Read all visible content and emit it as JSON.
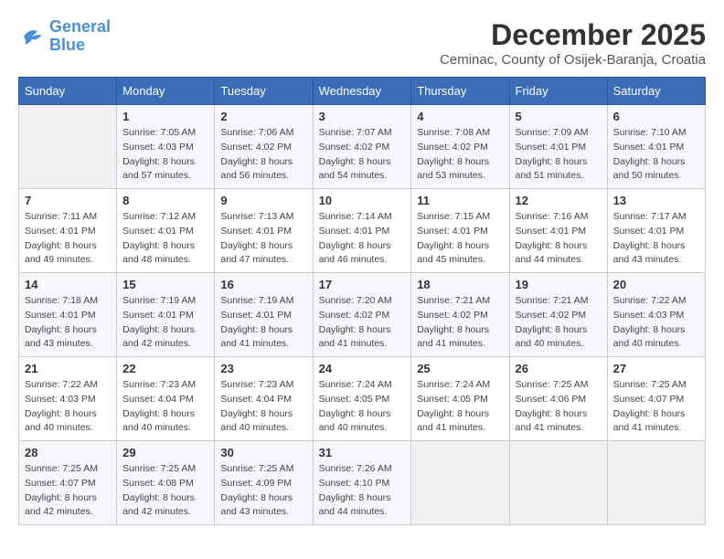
{
  "header": {
    "logo_line1": "General",
    "logo_line2": "Blue",
    "month": "December 2025",
    "location": "Ceminac, County of Osijek-Baranja, Croatia"
  },
  "weekdays": [
    "Sunday",
    "Monday",
    "Tuesday",
    "Wednesday",
    "Thursday",
    "Friday",
    "Saturday"
  ],
  "weeks": [
    [
      {
        "day": "",
        "info": ""
      },
      {
        "day": "1",
        "info": "Sunrise: 7:05 AM\nSunset: 4:03 PM\nDaylight: 8 hours\nand 57 minutes."
      },
      {
        "day": "2",
        "info": "Sunrise: 7:06 AM\nSunset: 4:02 PM\nDaylight: 8 hours\nand 56 minutes."
      },
      {
        "day": "3",
        "info": "Sunrise: 7:07 AM\nSunset: 4:02 PM\nDaylight: 8 hours\nand 54 minutes."
      },
      {
        "day": "4",
        "info": "Sunrise: 7:08 AM\nSunset: 4:02 PM\nDaylight: 8 hours\nand 53 minutes."
      },
      {
        "day": "5",
        "info": "Sunrise: 7:09 AM\nSunset: 4:01 PM\nDaylight: 8 hours\nand 51 minutes."
      },
      {
        "day": "6",
        "info": "Sunrise: 7:10 AM\nSunset: 4:01 PM\nDaylight: 8 hours\nand 50 minutes."
      }
    ],
    [
      {
        "day": "7",
        "info": "Sunrise: 7:11 AM\nSunset: 4:01 PM\nDaylight: 8 hours\nand 49 minutes."
      },
      {
        "day": "8",
        "info": "Sunrise: 7:12 AM\nSunset: 4:01 PM\nDaylight: 8 hours\nand 48 minutes."
      },
      {
        "day": "9",
        "info": "Sunrise: 7:13 AM\nSunset: 4:01 PM\nDaylight: 8 hours\nand 47 minutes."
      },
      {
        "day": "10",
        "info": "Sunrise: 7:14 AM\nSunset: 4:01 PM\nDaylight: 8 hours\nand 46 minutes."
      },
      {
        "day": "11",
        "info": "Sunrise: 7:15 AM\nSunset: 4:01 PM\nDaylight: 8 hours\nand 45 minutes."
      },
      {
        "day": "12",
        "info": "Sunrise: 7:16 AM\nSunset: 4:01 PM\nDaylight: 8 hours\nand 44 minutes."
      },
      {
        "day": "13",
        "info": "Sunrise: 7:17 AM\nSunset: 4:01 PM\nDaylight: 8 hours\nand 43 minutes."
      }
    ],
    [
      {
        "day": "14",
        "info": "Sunrise: 7:18 AM\nSunset: 4:01 PM\nDaylight: 8 hours\nand 43 minutes."
      },
      {
        "day": "15",
        "info": "Sunrise: 7:19 AM\nSunset: 4:01 PM\nDaylight: 8 hours\nand 42 minutes."
      },
      {
        "day": "16",
        "info": "Sunrise: 7:19 AM\nSunset: 4:01 PM\nDaylight: 8 hours\nand 41 minutes."
      },
      {
        "day": "17",
        "info": "Sunrise: 7:20 AM\nSunset: 4:02 PM\nDaylight: 8 hours\nand 41 minutes."
      },
      {
        "day": "18",
        "info": "Sunrise: 7:21 AM\nSunset: 4:02 PM\nDaylight: 8 hours\nand 41 minutes."
      },
      {
        "day": "19",
        "info": "Sunrise: 7:21 AM\nSunset: 4:02 PM\nDaylight: 8 hours\nand 40 minutes."
      },
      {
        "day": "20",
        "info": "Sunrise: 7:22 AM\nSunset: 4:03 PM\nDaylight: 8 hours\nand 40 minutes."
      }
    ],
    [
      {
        "day": "21",
        "info": "Sunrise: 7:22 AM\nSunset: 4:03 PM\nDaylight: 8 hours\nand 40 minutes."
      },
      {
        "day": "22",
        "info": "Sunrise: 7:23 AM\nSunset: 4:04 PM\nDaylight: 8 hours\nand 40 minutes."
      },
      {
        "day": "23",
        "info": "Sunrise: 7:23 AM\nSunset: 4:04 PM\nDaylight: 8 hours\nand 40 minutes."
      },
      {
        "day": "24",
        "info": "Sunrise: 7:24 AM\nSunset: 4:05 PM\nDaylight: 8 hours\nand 40 minutes."
      },
      {
        "day": "25",
        "info": "Sunrise: 7:24 AM\nSunset: 4:05 PM\nDaylight: 8 hours\nand 41 minutes."
      },
      {
        "day": "26",
        "info": "Sunrise: 7:25 AM\nSunset: 4:06 PM\nDaylight: 8 hours\nand 41 minutes."
      },
      {
        "day": "27",
        "info": "Sunrise: 7:25 AM\nSunset: 4:07 PM\nDaylight: 8 hours\nand 41 minutes."
      }
    ],
    [
      {
        "day": "28",
        "info": "Sunrise: 7:25 AM\nSunset: 4:07 PM\nDaylight: 8 hours\nand 42 minutes."
      },
      {
        "day": "29",
        "info": "Sunrise: 7:25 AM\nSunset: 4:08 PM\nDaylight: 8 hours\nand 42 minutes."
      },
      {
        "day": "30",
        "info": "Sunrise: 7:25 AM\nSunset: 4:09 PM\nDaylight: 8 hours\nand 43 minutes."
      },
      {
        "day": "31",
        "info": "Sunrise: 7:26 AM\nSunset: 4:10 PM\nDaylight: 8 hours\nand 44 minutes."
      },
      {
        "day": "",
        "info": ""
      },
      {
        "day": "",
        "info": ""
      },
      {
        "day": "",
        "info": ""
      }
    ]
  ]
}
